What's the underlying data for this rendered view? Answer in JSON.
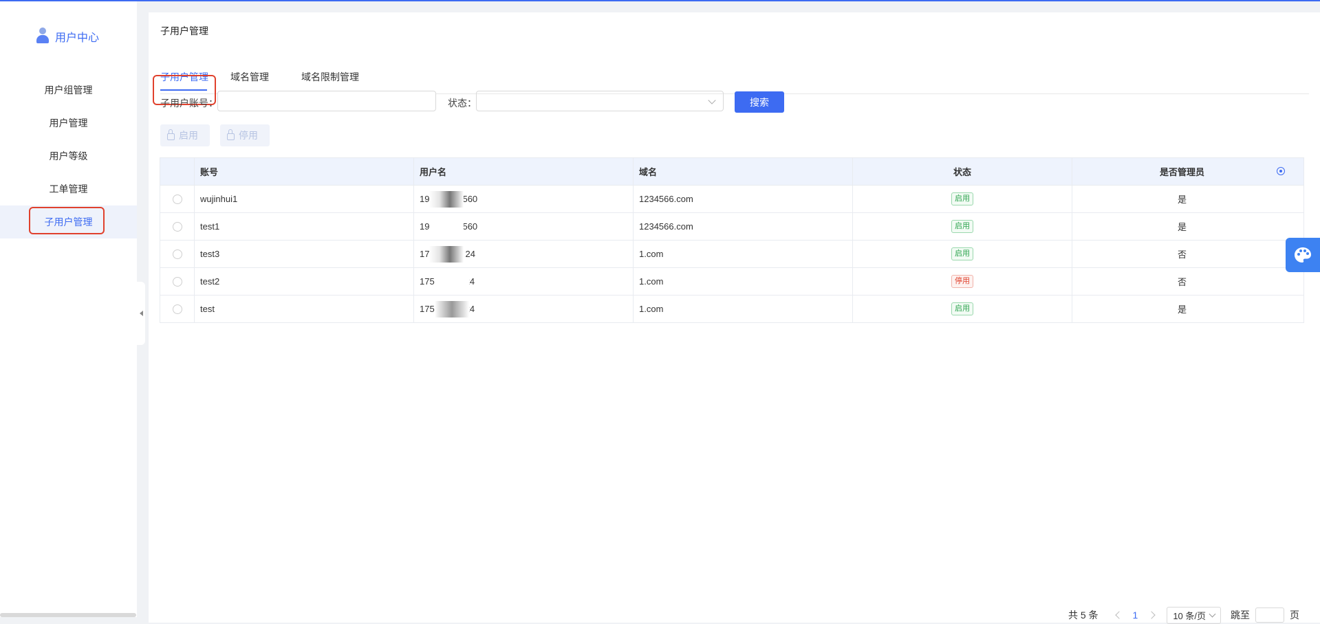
{
  "sidebar": {
    "brand": "用户中心",
    "items": [
      {
        "label": "用户组管理"
      },
      {
        "label": "用户管理"
      },
      {
        "label": "用户等级"
      },
      {
        "label": "工单管理"
      },
      {
        "label": "子用户管理"
      }
    ]
  },
  "main": {
    "page_title": "子用户管理",
    "tabs": [
      {
        "label": "子用户管理"
      },
      {
        "label": "域名管理"
      },
      {
        "label": "域名限制管理"
      }
    ],
    "filters": {
      "account_label": "子用户账号：",
      "account_value": "",
      "status_label": "状态：",
      "status_value": "",
      "search_label": "搜索"
    },
    "actions": {
      "enable_label": "启用",
      "disable_label": "停用"
    },
    "table": {
      "headers": [
        "账号",
        "用户名",
        "域名",
        "状态",
        "是否管理员"
      ],
      "rows": [
        {
          "account": "wujinhui1",
          "username_prefix": "19",
          "username_suffix": "560",
          "domain": "1234566.com",
          "status": "启用",
          "admin": "是"
        },
        {
          "account": "test1",
          "username_prefix": "19",
          "username_suffix": "560",
          "domain": "1234566.com",
          "status": "启用",
          "admin": "是"
        },
        {
          "account": "test3",
          "username_prefix": "17",
          "username_suffix": "24",
          "domain": "1.com",
          "status": "启用",
          "admin": "否"
        },
        {
          "account": "test2",
          "username_prefix": "175",
          "username_suffix": "24",
          "domain": "1.com",
          "status": "停用",
          "admin": "否"
        },
        {
          "account": "test",
          "username_prefix": "175",
          "username_suffix": "24",
          "domain": "1.com",
          "status": "启用",
          "admin": "是"
        }
      ]
    },
    "pagination": {
      "total": "共 5 条",
      "current_page": "1",
      "page_size": "10 条/页",
      "jump_label": "跳至",
      "page_suffix": "页"
    }
  },
  "colors": {
    "accent": "#3d6bf2",
    "highlight_border": "#e0412d",
    "status_enabled": "#2ea44f",
    "status_disabled": "#e0412d"
  },
  "icons": [
    "user-icon",
    "lock-icon",
    "settings-icon",
    "palette-icon",
    "chevron-down-icon",
    "chevron-left-icon",
    "chevron-right-icon"
  ]
}
